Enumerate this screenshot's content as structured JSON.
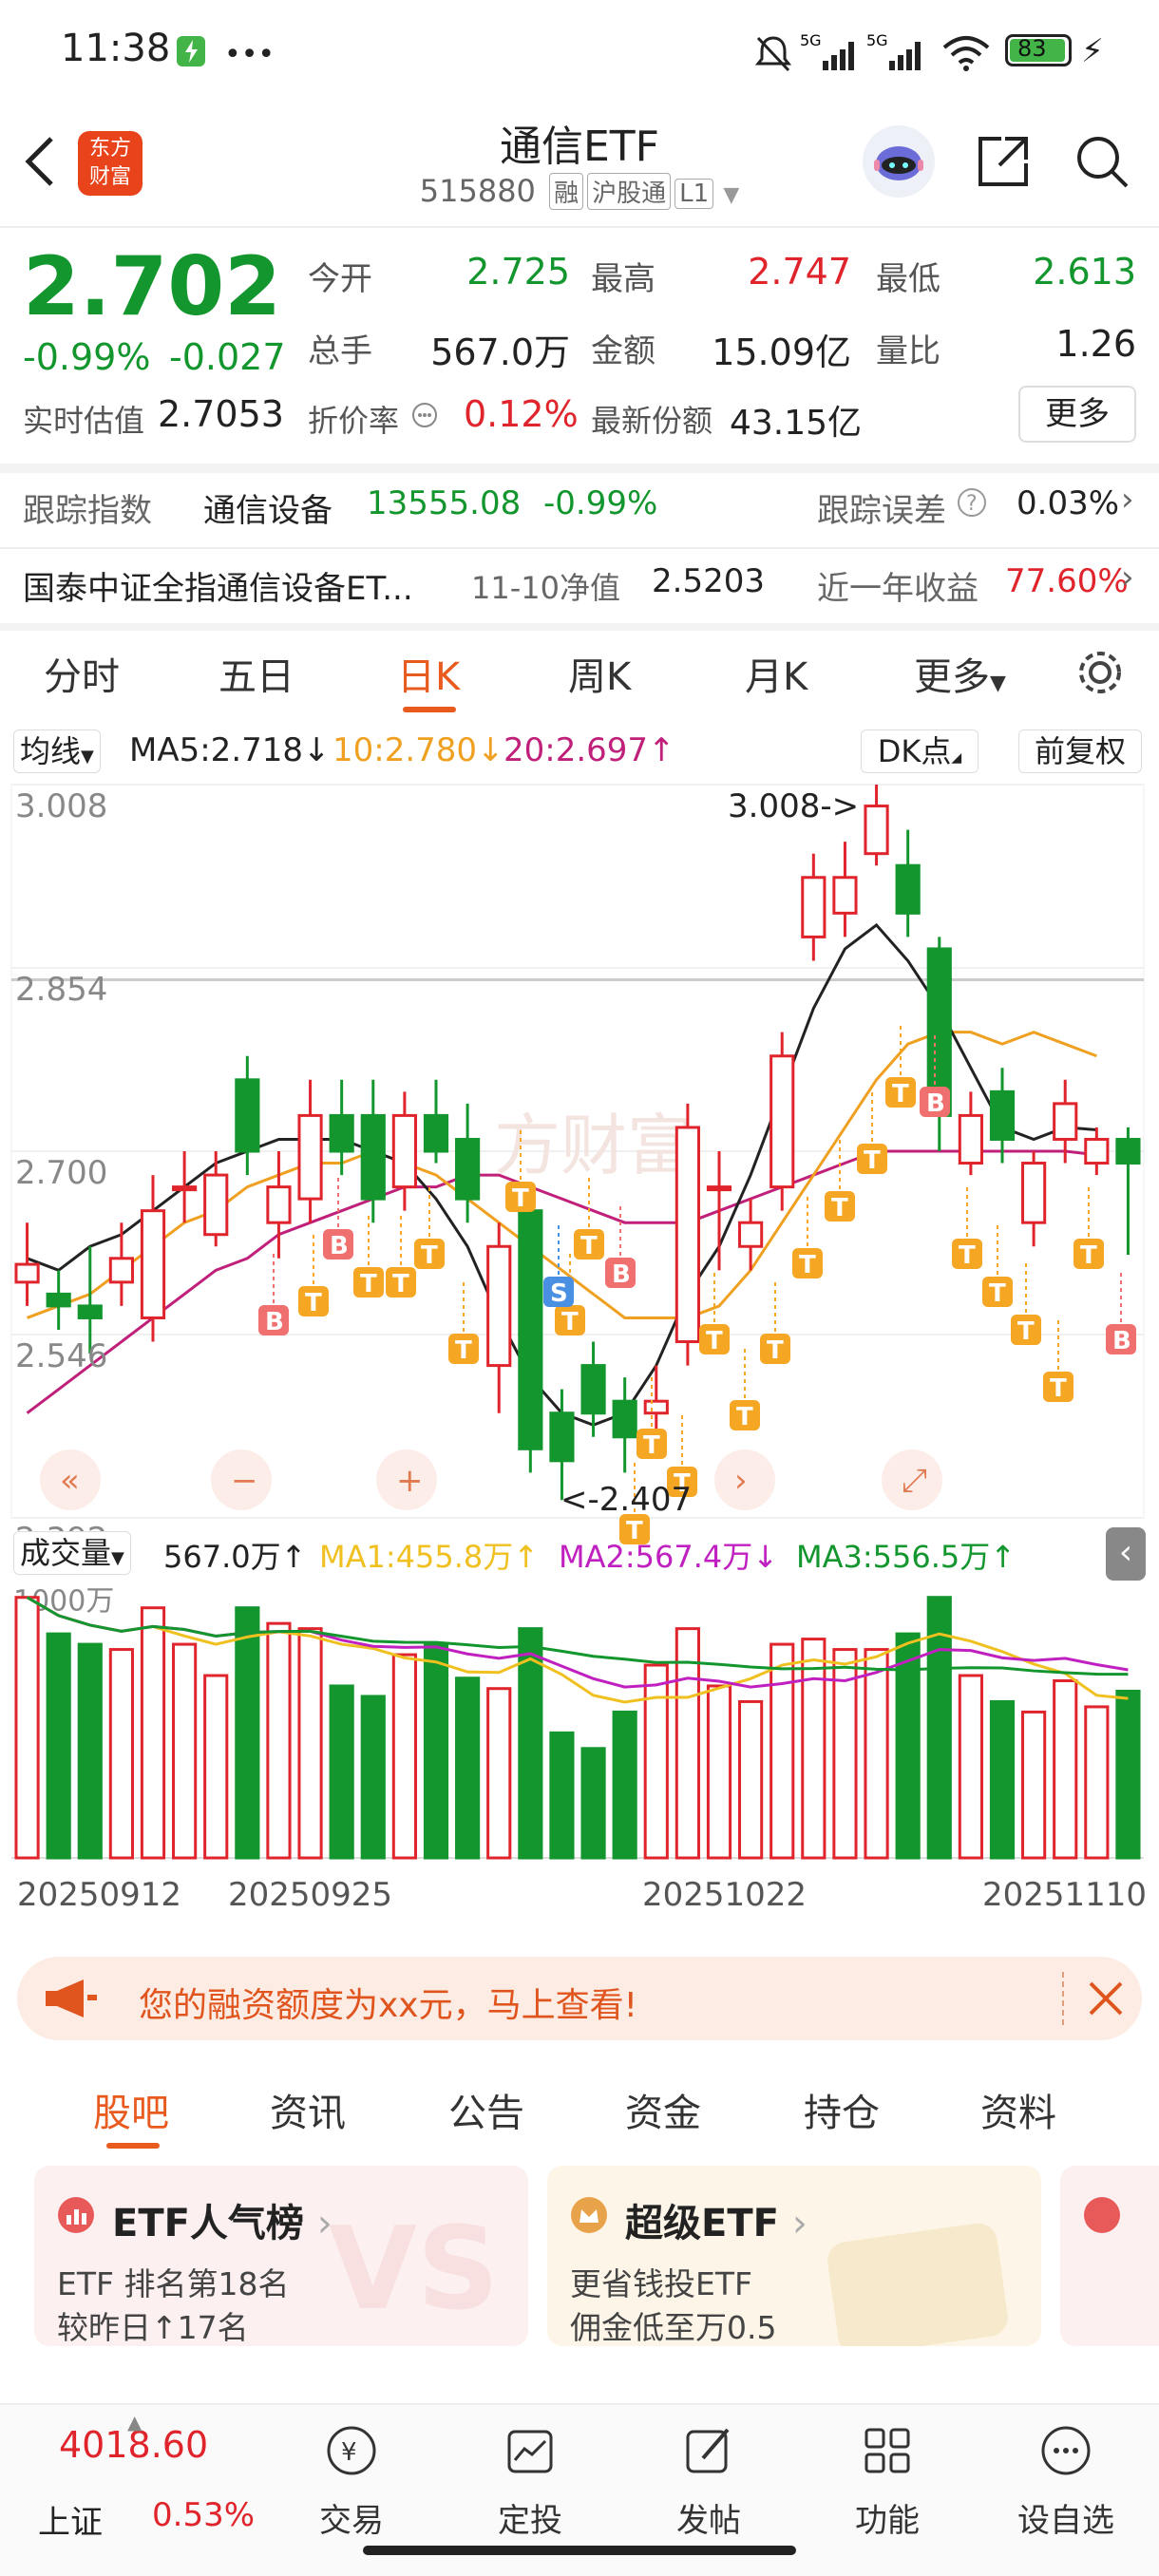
{
  "status_bar": {
    "time": "11:38",
    "battery": "83",
    "network": "5G"
  },
  "header": {
    "title": "通信ETF",
    "code": "515880",
    "tags": [
      "融",
      "沪股通",
      "L1"
    ],
    "logo_text": [
      "东方",
      "财富"
    ]
  },
  "quote": {
    "price": "2.702",
    "change_pct": "-0.99%",
    "change": "-0.027",
    "open_label": "今开",
    "open": "2.725",
    "high_label": "最高",
    "high": "2.747",
    "low_label": "最低",
    "low": "2.613",
    "volume_label": "总手",
    "volume": "567.0万",
    "amount_label": "金额",
    "amount": "15.09亿",
    "ratio_label": "量比",
    "ratio": "1.26",
    "estimate_label": "实时估值",
    "estimate": "2.7053",
    "discount_label": "折价率",
    "discount": "0.12%",
    "shares_label": "最新份额",
    "shares": "43.15亿",
    "more_button": "更多"
  },
  "tracking": {
    "index_label": "跟踪指数",
    "index_name": "通信设备",
    "index_value": "13555.08",
    "index_change": "-0.99%",
    "error_label": "跟踪误差",
    "error_value": "0.03%",
    "fund_name": "国泰中证全指通信设备ET...",
    "nav_label": "11-10净值",
    "nav_value": "2.5203",
    "return_label": "近一年收益",
    "return_value": "77.60%"
  },
  "chart_tabs": [
    "分时",
    "五日",
    "日K",
    "周K",
    "月K",
    "更多"
  ],
  "chart_tab_active": "日K",
  "ma_bar": {
    "selector": "均线",
    "ma5": "MA5:2.718",
    "ma10": "10:2.780",
    "ma20": "20:2.697",
    "dk": "DK点",
    "adjust": "前复权"
  },
  "volume_bar": {
    "selector": "成交量",
    "vol": "567.0万",
    "ma1": "MA1:455.8万",
    "ma2": "MA2:567.4万",
    "ma3": "MA3:556.5万"
  },
  "colors": {
    "up": "#e0242c",
    "down": "#12962d",
    "ma5": "#222222",
    "ma10": "#f0a020",
    "ma20": "#c0207a",
    "accent": "#e85a1e"
  },
  "chart_data": {
    "type": "candlestick",
    "price_axis": [
      "3.008",
      "2.854",
      "2.700",
      "2.546",
      "2.392"
    ],
    "volume_axis_label": "1000万",
    "dates": [
      "20250912",
      "20250925",
      "20251022",
      "20251110"
    ],
    "annotations": {
      "high": "3.008->",
      "low": "<-2.407"
    },
    "ylim": [
      2.392,
      3.008
    ],
    "candles": [
      [
        2.59,
        2.605,
        2.64,
        2.57
      ],
      [
        2.58,
        2.57,
        2.6,
        2.55
      ],
      [
        2.57,
        2.56,
        2.62,
        2.53
      ],
      [
        2.59,
        2.61,
        2.64,
        2.57
      ],
      [
        2.56,
        2.65,
        2.68,
        2.54
      ],
      [
        2.67,
        2.67,
        2.7,
        2.64
      ],
      [
        2.63,
        2.68,
        2.7,
        2.62
      ],
      [
        2.76,
        2.7,
        2.78,
        2.68
      ],
      [
        2.64,
        2.67,
        2.7,
        2.61
      ],
      [
        2.66,
        2.73,
        2.76,
        2.64
      ],
      [
        2.73,
        2.7,
        2.76,
        2.68
      ],
      [
        2.73,
        2.66,
        2.76,
        2.64
      ],
      [
        2.67,
        2.73,
        2.75,
        2.65
      ],
      [
        2.73,
        2.7,
        2.76,
        2.69
      ],
      [
        2.71,
        2.66,
        2.74,
        2.64
      ],
      [
        2.52,
        2.62,
        2.64,
        2.48
      ],
      [
        2.65,
        2.45,
        2.66,
        2.43
      ],
      [
        2.48,
        2.44,
        2.5,
        2.407
      ],
      [
        2.52,
        2.48,
        2.54,
        2.46
      ],
      [
        2.49,
        2.46,
        2.51,
        2.43
      ],
      [
        2.48,
        2.49,
        2.52,
        2.46
      ],
      [
        2.54,
        2.72,
        2.74,
        2.52
      ],
      [
        2.67,
        2.67,
        2.7,
        2.6
      ],
      [
        2.62,
        2.64,
        2.66,
        2.6
      ],
      [
        2.67,
        2.78,
        2.8,
        2.65
      ],
      [
        2.88,
        2.93,
        2.95,
        2.86
      ],
      [
        2.9,
        2.93,
        2.96,
        2.88
      ],
      [
        2.95,
        2.99,
        3.008,
        2.94
      ],
      [
        2.94,
        2.9,
        2.97,
        2.88
      ],
      [
        2.87,
        2.73,
        2.88,
        2.7
      ],
      [
        2.69,
        2.73,
        2.75,
        2.68
      ],
      [
        2.75,
        2.71,
        2.77,
        2.69
      ],
      [
        2.64,
        2.69,
        2.7,
        2.62
      ],
      [
        2.71,
        2.74,
        2.76,
        2.69
      ],
      [
        2.69,
        2.71,
        2.72,
        2.68
      ],
      [
        2.71,
        2.69,
        2.72,
        2.613
      ]
    ],
    "ma5": [
      2.61,
      2.6,
      2.62,
      2.63,
      2.65,
      2.67,
      2.69,
      2.7,
      2.71,
      2.71,
      2.71,
      2.7,
      2.69,
      2.66,
      2.62,
      2.56,
      2.51,
      2.48,
      2.47,
      2.48,
      2.52,
      2.58,
      2.62,
      2.68,
      2.75,
      2.82,
      2.87,
      2.89,
      2.86,
      2.82,
      2.77,
      2.72,
      2.71,
      2.72,
      2.718
    ],
    "ma10": [
      2.56,
      2.57,
      2.58,
      2.6,
      2.62,
      2.64,
      2.65,
      2.67,
      2.68,
      2.69,
      2.69,
      2.7,
      2.69,
      2.68,
      2.66,
      2.64,
      2.62,
      2.6,
      2.58,
      2.56,
      2.56,
      2.56,
      2.57,
      2.6,
      2.64,
      2.68,
      2.72,
      2.76,
      2.79,
      2.8,
      2.8,
      2.79,
      2.8,
      2.79,
      2.78
    ],
    "ma20": [
      2.48,
      2.5,
      2.52,
      2.54,
      2.56,
      2.58,
      2.6,
      2.61,
      2.63,
      2.64,
      2.65,
      2.66,
      2.67,
      2.67,
      2.68,
      2.68,
      2.67,
      2.66,
      2.65,
      2.64,
      2.64,
      2.64,
      2.65,
      2.66,
      2.67,
      2.68,
      2.69,
      2.7,
      2.7,
      2.7,
      2.7,
      2.7,
      2.7,
      2.7,
      2.697
    ],
    "volumes": [
      1000,
      860,
      820,
      800,
      960,
      820,
      700,
      960,
      900,
      880,
      660,
      620,
      780,
      820,
      690,
      650,
      880,
      480,
      420,
      560,
      740,
      880,
      660,
      600,
      820,
      840,
      800,
      800,
      860,
      1000,
      700,
      600,
      560,
      680,
      580,
      640
    ],
    "markers": [
      "B",
      "T",
      "B",
      "T",
      "T",
      "T",
      "T",
      "T",
      "T",
      "S",
      "T",
      "B",
      "T",
      "T",
      "T",
      "T",
      "T",
      "T",
      "T",
      "T",
      "T",
      "T",
      "B",
      "T",
      "T",
      "T",
      "T",
      "T",
      "B"
    ]
  },
  "banner": {
    "text": "您的融资额度为xx元，马上查看!"
  },
  "lower_tabs": [
    "股吧",
    "资讯",
    "公告",
    "资金",
    "持仓",
    "资料"
  ],
  "lower_tab_active": "股吧",
  "cards": [
    {
      "title": "ETF人气榜",
      "line1": "ETF 排名第18名",
      "line2": "较昨日↑17名"
    },
    {
      "title": "超级ETF",
      "line1": "更省钱投ETF",
      "line2": "佣金低至万0.5"
    }
  ],
  "bottom_nav": {
    "index_value": "4018.60",
    "index_name": "上证",
    "index_change": "0.53%",
    "items": [
      "交易",
      "定投",
      "发帖",
      "功能",
      "设自选"
    ]
  }
}
